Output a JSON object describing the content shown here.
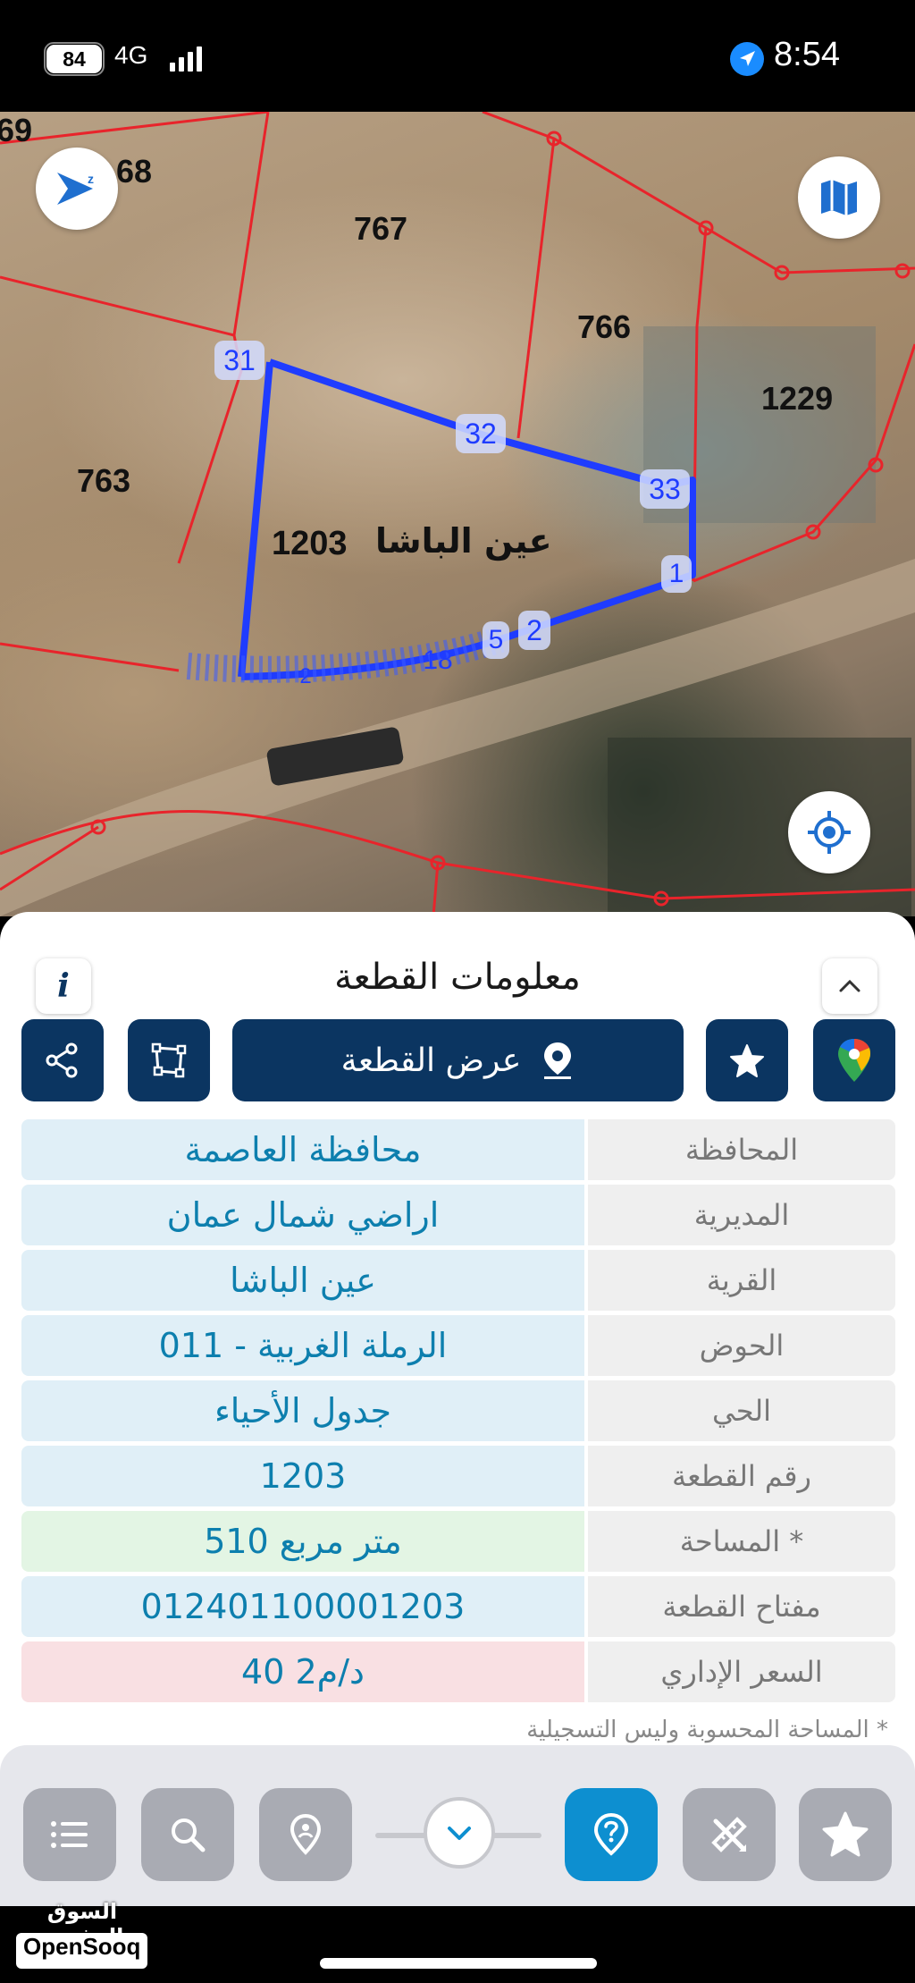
{
  "status_bar": {
    "battery": "84",
    "network": "4G",
    "time": "8:54"
  },
  "map": {
    "plot_labels": [
      {
        "text": "69"
      },
      {
        "text": "68"
      },
      {
        "text": "767"
      },
      {
        "text": "766"
      },
      {
        "text": "1229"
      },
      {
        "text": "763"
      },
      {
        "text": "1203"
      }
    ],
    "plot_name": "عين الباشا",
    "vertex_labels": [
      "31",
      "32",
      "33",
      "1",
      "2",
      "5",
      "2",
      "18"
    ],
    "parcel_outline_color": "#1f3cff",
    "boundary_color": "#e8242b",
    "compass_letter": "z"
  },
  "panel": {
    "title": "معلومات القطعة",
    "show_parcel_label": "عرض القطعة",
    "rows": [
      {
        "label": "المحافظة",
        "value": "محافظة العاصمة",
        "tone": "blue"
      },
      {
        "label": "المديرية",
        "value": "اراضي شمال عمان",
        "tone": "blue"
      },
      {
        "label": "القرية",
        "value": "عين الباشا",
        "tone": "blue"
      },
      {
        "label": "الحوض",
        "value": "الرملة الغربية - 011",
        "tone": "blue"
      },
      {
        "label": "الحي",
        "value": "جدول الأحياء",
        "tone": "blue"
      },
      {
        "label": "رقم القطعة",
        "value": "1203",
        "tone": "blue"
      },
      {
        "label": "المساحة *",
        "value": "510  متر مربع",
        "tone": "green"
      },
      {
        "label": "مفتاح القطعة",
        "value": "012401100001203",
        "tone": "blue"
      },
      {
        "label": "السعر الإداري",
        "value": "40 د/م2",
        "tone": "red"
      }
    ],
    "footnote": "* المساحة المحسوبة وليس التسجيلية"
  },
  "watermark": {
    "arabic": "السوق المفتوح",
    "english": "OpenSooq"
  },
  "colors": {
    "primary_dark": "#0b3561",
    "accent_blue": "#0d8fd0",
    "value_text": "#0d7fae"
  }
}
